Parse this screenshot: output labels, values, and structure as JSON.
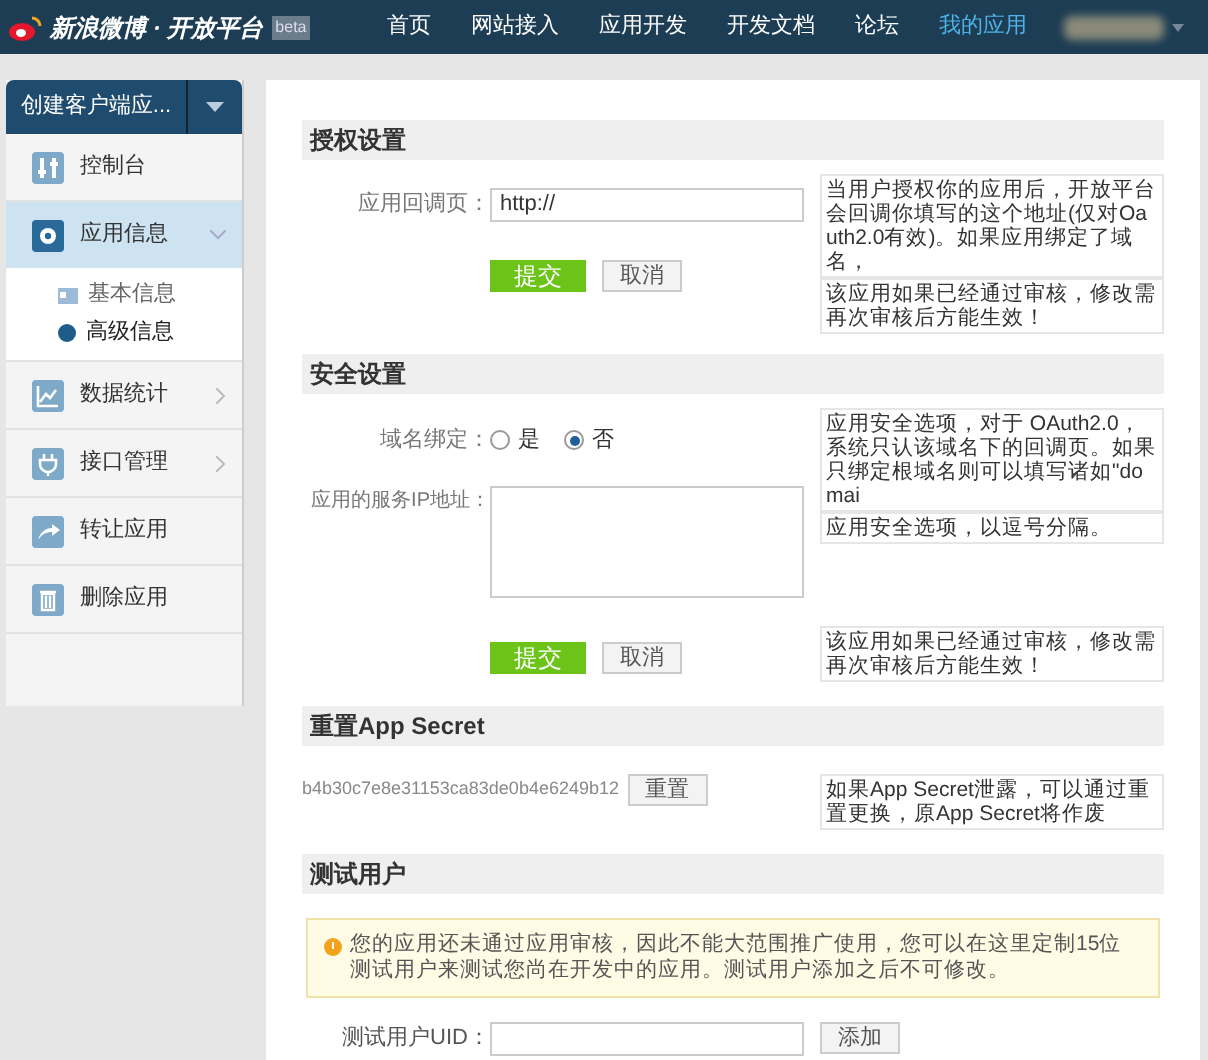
{
  "nav": {
    "logo": "新浪微博 · 开放平台",
    "badge": "beta",
    "items": [
      {
        "label": "首页",
        "selected": false
      },
      {
        "label": "网站接入",
        "selected": false
      },
      {
        "label": "应用开发",
        "selected": false
      },
      {
        "label": "开发文档",
        "selected": false
      },
      {
        "label": "论坛",
        "selected": false
      },
      {
        "label": "我的应用",
        "selected": true
      }
    ]
  },
  "sidebar": {
    "app_menu": "创建客户端应...",
    "items": [
      {
        "label": "控制台",
        "kind": "link",
        "selected": false
      },
      {
        "label": "应用信息",
        "kind": "group",
        "selected": true,
        "expanded": true,
        "children": [
          {
            "label": "基本信息",
            "selected": false
          },
          {
            "label": "高级信息",
            "selected": true
          }
        ]
      },
      {
        "label": "数据统计",
        "kind": "group",
        "selected": false,
        "expanded": false
      },
      {
        "label": "接口管理",
        "kind": "group",
        "selected": false,
        "expanded": false
      },
      {
        "label": "转让应用",
        "kind": "link",
        "selected": false
      },
      {
        "label": "删除应用",
        "kind": "link",
        "selected": false
      }
    ]
  },
  "sections": [
    {
      "title": "授权设置",
      "kind": "callback",
      "label": "应用回调页：",
      "value": "http://",
      "submit": "提交",
      "cancel": "取消",
      "hints": [
        "当用户授权你的应用后，开放平台会回调你填写的这个地址(仅对Oauth2.0有效)。如果应用绑定了域名，",
        "该应用如果已经通过审核，修改需再次审核后方能生效！"
      ]
    },
    {
      "title": "安全设置",
      "kind": "security",
      "label": "域名绑定：",
      "options": [
        {
          "label": "是",
          "selected": false
        },
        {
          "label": "否",
          "selected": true
        }
      ],
      "ip_label": "应用的服务IP地址：",
      "submit": "提交",
      "cancel": "取消",
      "hints": [
        "应用安全选项，对于 OAuth2.0，系统只认该域名下的回调页。如果只绑定根域名则可以填写诸如\"domai",
        "应用安全选项，以逗号分隔。"
      ],
      "submit_hint": "该应用如果已经通过审核，修改需再次审核后方能生效！"
    },
    {
      "title": "重置App Secret",
      "kind": "secret",
      "secret": "b4b30c7e8e31153ca83de0b4e6249b12",
      "button": "重置",
      "hint": "如果App Secret泄露，可以通过重置更换，原App Secret将作废"
    },
    {
      "title": "测试用户",
      "kind": "testers",
      "notice": "您的应用还未通过应用审核，因此不能大范围推广使用，您可以在这里定制15位测试用户来测试您尚在开发中的应用。测试用户添加之后不可修改。",
      "label": "测试用户UID：",
      "button": "添加"
    }
  ]
}
